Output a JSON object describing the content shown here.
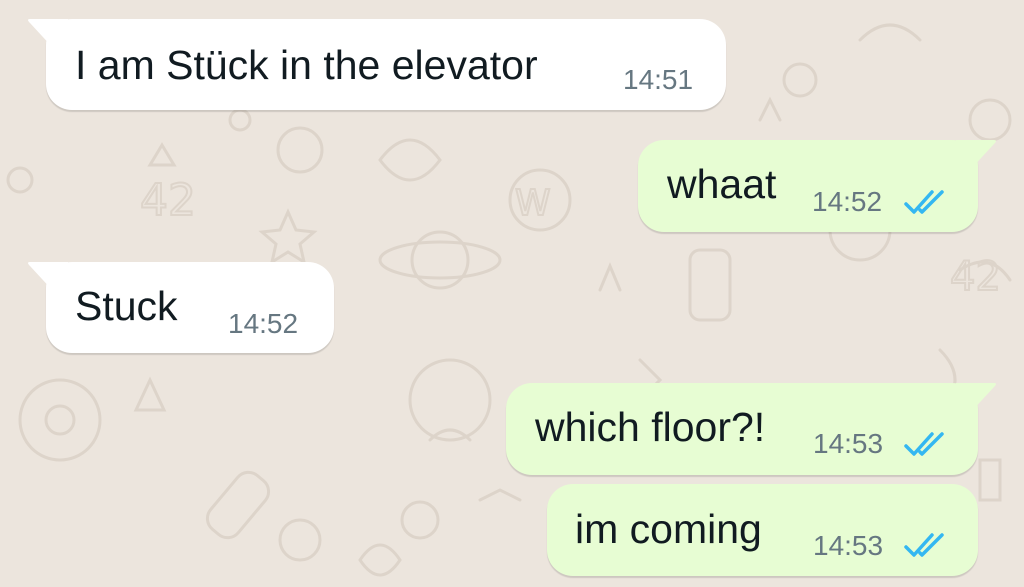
{
  "theme": {
    "wallpaper": "#ece5dd",
    "incoming_bubble": "#ffffff",
    "outgoing_bubble": "#e7fdd3",
    "read_ticks": "#34b7f1"
  },
  "messages": [
    {
      "direction": "incoming",
      "text": "I am Stück in the elevator",
      "time": "14:51"
    },
    {
      "direction": "outgoing",
      "text": "whaat",
      "time": "14:52",
      "status": "read"
    },
    {
      "direction": "incoming",
      "text": "Stuck",
      "time": "14:52"
    },
    {
      "direction": "outgoing",
      "text": "which floor?!",
      "time": "14:53",
      "status": "read"
    },
    {
      "direction": "outgoing",
      "text": "im coming",
      "time": "14:53",
      "status": "read"
    }
  ]
}
